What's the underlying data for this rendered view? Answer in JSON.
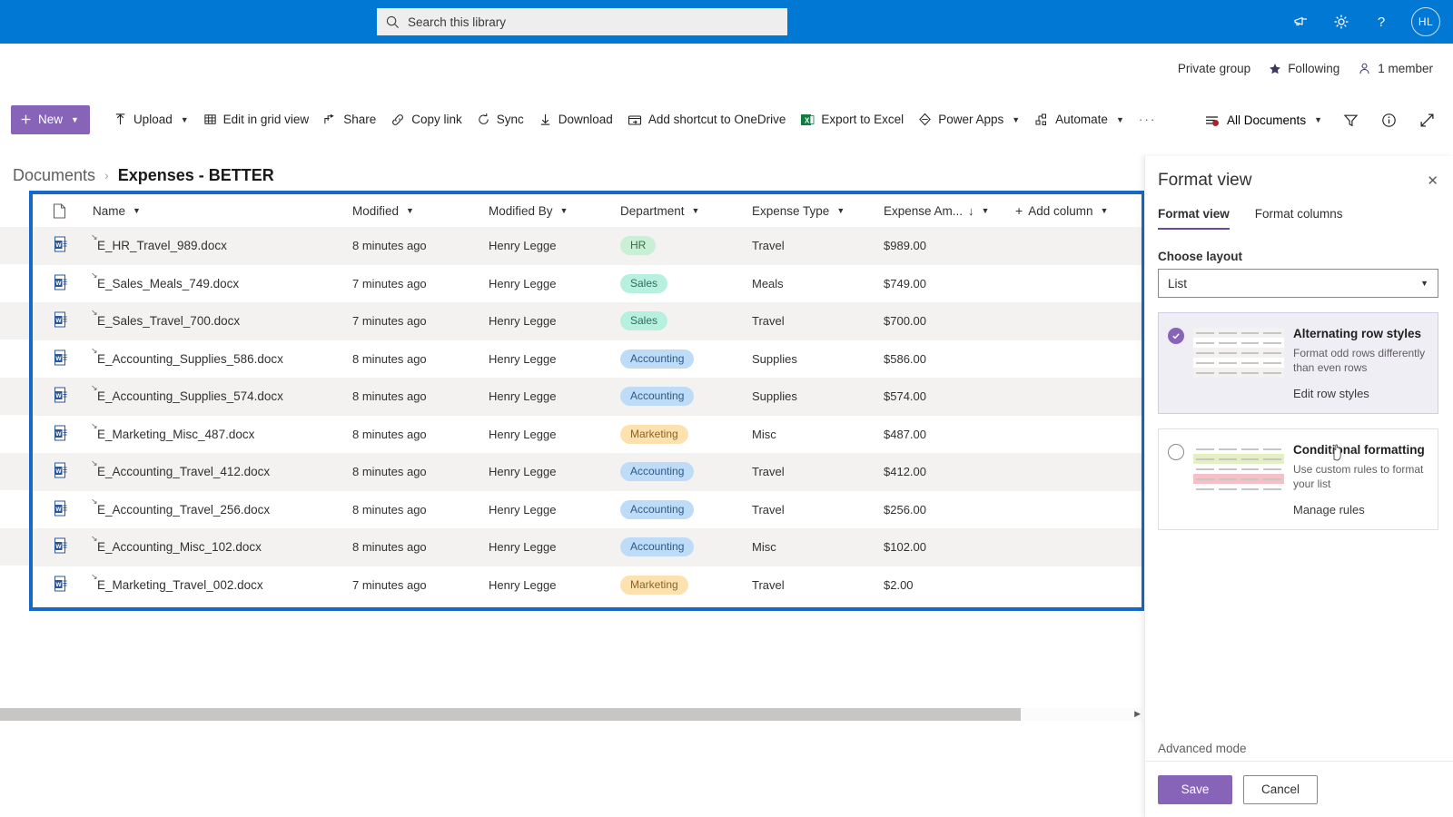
{
  "suite": {
    "search_placeholder": "Search this library",
    "icons": [
      "megaphone-icon",
      "gear-icon",
      "help-icon"
    ],
    "avatar_initials": "HL",
    "brand_color": "#0078d4"
  },
  "site": {
    "privacy": "Private group",
    "following": "Following",
    "members": "1 member"
  },
  "commandbar": {
    "new_label": "New",
    "items": [
      {
        "label": "Upload",
        "icon": "upload-icon",
        "chevron": true
      },
      {
        "label": "Edit in grid view",
        "icon": "grid-icon",
        "chevron": false
      },
      {
        "label": "Share",
        "icon": "share-icon",
        "chevron": false
      },
      {
        "label": "Copy link",
        "icon": "link-icon",
        "chevron": false
      },
      {
        "label": "Sync",
        "icon": "sync-icon",
        "chevron": false
      },
      {
        "label": "Download",
        "icon": "download-icon",
        "chevron": false
      },
      {
        "label": "Add shortcut to OneDrive",
        "icon": "onedrive-shortcut-icon",
        "chevron": false
      },
      {
        "label": "Export to Excel",
        "icon": "excel-icon",
        "chevron": false
      },
      {
        "label": "Power Apps",
        "icon": "power-apps-icon",
        "chevron": true
      },
      {
        "label": "Automate",
        "icon": "automate-icon",
        "chevron": true
      }
    ],
    "overflow_label": "···",
    "view_name": "All Documents",
    "view_has_unsaved_changes": true,
    "right_icons": [
      "filter-icon",
      "info-icon",
      "expand-icon"
    ]
  },
  "breadcrumb": {
    "parent": "Documents",
    "separator": "›",
    "current": "Expenses - BETTER"
  },
  "list": {
    "columns": [
      {
        "label": "Name",
        "chevron": true
      },
      {
        "label": "Modified",
        "chevron": true
      },
      {
        "label": "Modified By",
        "chevron": true
      },
      {
        "label": "Department",
        "chevron": true
      },
      {
        "label": "Expense Type",
        "chevron": true
      },
      {
        "label": "Expense Am...",
        "chevron": true,
        "sort": "↓"
      },
      {
        "label": "Add column",
        "chevron": true,
        "prefix": "+"
      }
    ],
    "rows": [
      {
        "name": "E_HR_Travel_989.docx",
        "modified": "8 minutes ago",
        "modified_by": "Henry Legge",
        "department": "HR",
        "dept_class": "p-hr",
        "expense_type": "Travel",
        "amount": "$989.00"
      },
      {
        "name": "E_Sales_Meals_749.docx",
        "modified": "7 minutes ago",
        "modified_by": "Henry Legge",
        "department": "Sales",
        "dept_class": "p-sales",
        "expense_type": "Meals",
        "amount": "$749.00"
      },
      {
        "name": "E_Sales_Travel_700.docx",
        "modified": "7 minutes ago",
        "modified_by": "Henry Legge",
        "department": "Sales",
        "dept_class": "p-sales",
        "expense_type": "Travel",
        "amount": "$700.00"
      },
      {
        "name": "E_Accounting_Supplies_586.docx",
        "modified": "8 minutes ago",
        "modified_by": "Henry Legge",
        "department": "Accounting",
        "dept_class": "p-acct",
        "expense_type": "Supplies",
        "amount": "$586.00"
      },
      {
        "name": "E_Accounting_Supplies_574.docx",
        "modified": "8 minutes ago",
        "modified_by": "Henry Legge",
        "department": "Accounting",
        "dept_class": "p-acct",
        "expense_type": "Supplies",
        "amount": "$574.00"
      },
      {
        "name": "E_Marketing_Misc_487.docx",
        "modified": "8 minutes ago",
        "modified_by": "Henry Legge",
        "department": "Marketing",
        "dept_class": "p-mkt",
        "expense_type": "Misc",
        "amount": "$487.00"
      },
      {
        "name": "E_Accounting_Travel_412.docx",
        "modified": "8 minutes ago",
        "modified_by": "Henry Legge",
        "department": "Accounting",
        "dept_class": "p-acct",
        "expense_type": "Travel",
        "amount": "$412.00"
      },
      {
        "name": "E_Accounting_Travel_256.docx",
        "modified": "8 minutes ago",
        "modified_by": "Henry Legge",
        "department": "Accounting",
        "dept_class": "p-acct",
        "expense_type": "Travel",
        "amount": "$256.00"
      },
      {
        "name": "E_Accounting_Misc_102.docx",
        "modified": "8 minutes ago",
        "modified_by": "Henry Legge",
        "department": "Accounting",
        "dept_class": "p-acct",
        "expense_type": "Misc",
        "amount": "$102.00"
      },
      {
        "name": "E_Marketing_Travel_002.docx",
        "modified": "7 minutes ago",
        "modified_by": "Henry Legge",
        "department": "Marketing",
        "dept_class": "p-mkt",
        "expense_type": "Travel",
        "amount": "$2.00"
      }
    ],
    "pill_colors": {
      "HR": "#c9f0d4",
      "Sales": "#b8f0e0",
      "Accounting": "#bedcf7",
      "Marketing": "#fde2b0"
    },
    "highlight_border_color": "#1668c9"
  },
  "panel": {
    "title": "Format view",
    "close_icon": "close-icon",
    "tabs": [
      {
        "label": "Format view",
        "active": true
      },
      {
        "label": "Format columns",
        "active": false
      }
    ],
    "layout_label": "Choose layout",
    "layout_value": "List",
    "options": [
      {
        "title": "Alternating row styles",
        "description": "Format odd rows differently than even rows",
        "link": "Edit row styles",
        "selected": true
      },
      {
        "title": "Conditional formatting",
        "description": "Use custom rules to format your list",
        "link": "Manage rules",
        "selected": false
      }
    ],
    "advanced_mode": "Advanced mode",
    "save_label": "Save",
    "cancel_label": "Cancel",
    "accent_color": "#8764b8"
  }
}
